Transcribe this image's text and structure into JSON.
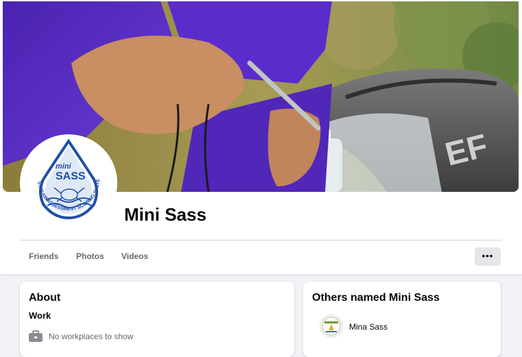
{
  "profile": {
    "name": "Mini Sass",
    "logo": {
      "top_text": "mini",
      "main_text": "SASS",
      "ring_text": "STREAM ASSESSMENT SCORING SYSTEM"
    }
  },
  "tabs": [
    {
      "label": "Friends"
    },
    {
      "label": "Photos"
    },
    {
      "label": "Videos"
    }
  ],
  "more_button": {
    "label": "•••"
  },
  "about": {
    "title": "About",
    "work_section": "Work",
    "no_workplaces": "No workplaces to show",
    "icon": "briefcase-icon"
  },
  "others": {
    "title": "Others named Mini Sass",
    "items": [
      {
        "name": "Mina Sass"
      }
    ]
  },
  "colors": {
    "brand_blue": "#1f4fa8",
    "secondary_text": "#65676b",
    "cover_purple": "#5b2fc4"
  }
}
